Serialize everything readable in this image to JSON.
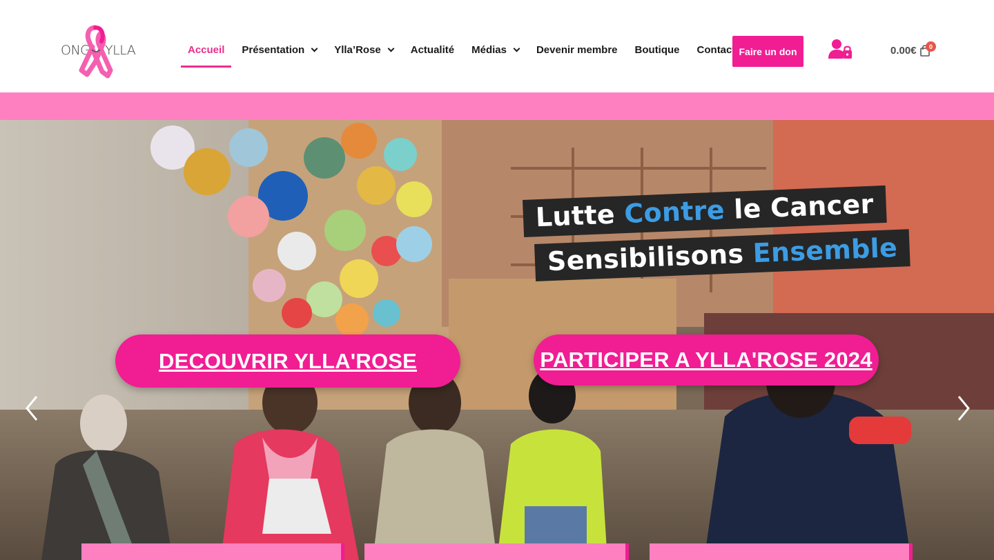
{
  "brand": {
    "logo_left": "ONG",
    "logo_right": "YLLA",
    "accent_color": "#f11d93",
    "accent_light": "#ff80c1"
  },
  "nav": {
    "items": [
      {
        "label": "Accueil",
        "active": true,
        "dropdown": false
      },
      {
        "label": "Présentation",
        "active": false,
        "dropdown": true
      },
      {
        "label": "Ylla’Rose",
        "active": false,
        "dropdown": true
      },
      {
        "label": "Actualité",
        "active": false,
        "dropdown": false
      },
      {
        "label": "Médias",
        "active": false,
        "dropdown": true
      },
      {
        "label": "Devenir membre",
        "active": false,
        "dropdown": false
      },
      {
        "label": "Boutique",
        "active": false,
        "dropdown": false
      },
      {
        "label": "Contacts",
        "active": false,
        "dropdown": false
      }
    ],
    "donate_label": "Faire un don",
    "account_icon": "user-lock-icon"
  },
  "cart": {
    "total": "0.00€",
    "count": "0",
    "icon": "shopping-bag-icon"
  },
  "hero": {
    "headline_1": {
      "w1": "Lutte",
      "w2": "Contre",
      "w3": "le Cancer"
    },
    "headline_2": {
      "w1": "Sensibilisons",
      "w2": "Ensemble"
    },
    "headline_accent": "#3c9ce4",
    "cta_primary": "DECOUVRIR YLLA'ROSE",
    "cta_secondary": "PARTICIPER A YLLA'ROSE 2024",
    "prev_icon": "chevron-left-icon",
    "next_icon": "chevron-right-icon"
  }
}
